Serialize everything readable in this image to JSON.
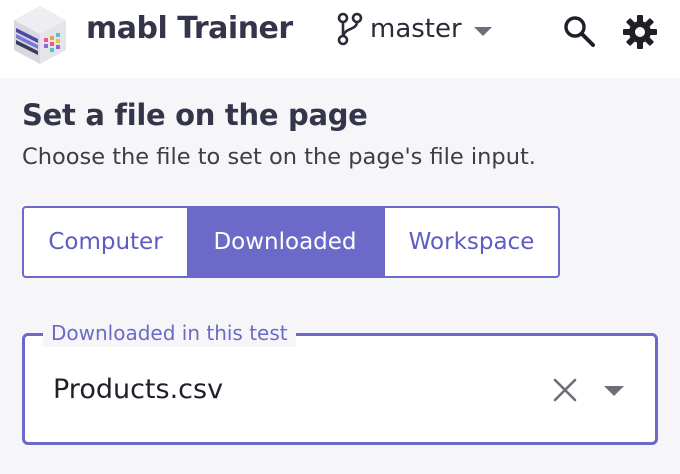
{
  "header": {
    "app_title": "mabl Trainer",
    "branch": "master",
    "logo_icon": "mabl-cube-logo-icon",
    "branch_icon": "git-branch-icon",
    "search_icon": "search-icon",
    "settings_icon": "gear-icon"
  },
  "section": {
    "title": "Set a file on the page",
    "subtitle": "Choose the file to set on the page's file input."
  },
  "tabs": [
    {
      "label": "Computer",
      "selected": false
    },
    {
      "label": "Downloaded",
      "selected": true
    },
    {
      "label": "Workspace",
      "selected": false
    }
  ],
  "file_select": {
    "label": "Downloaded in this test",
    "value": "Products.csv",
    "clear_icon": "close-icon",
    "dropdown_icon": "caret-down-icon"
  },
  "colors": {
    "accent": "#6c6ac8",
    "header_bg": "#ffffff",
    "page_bg": "#f6f6f8",
    "title_text": "#34344a"
  }
}
